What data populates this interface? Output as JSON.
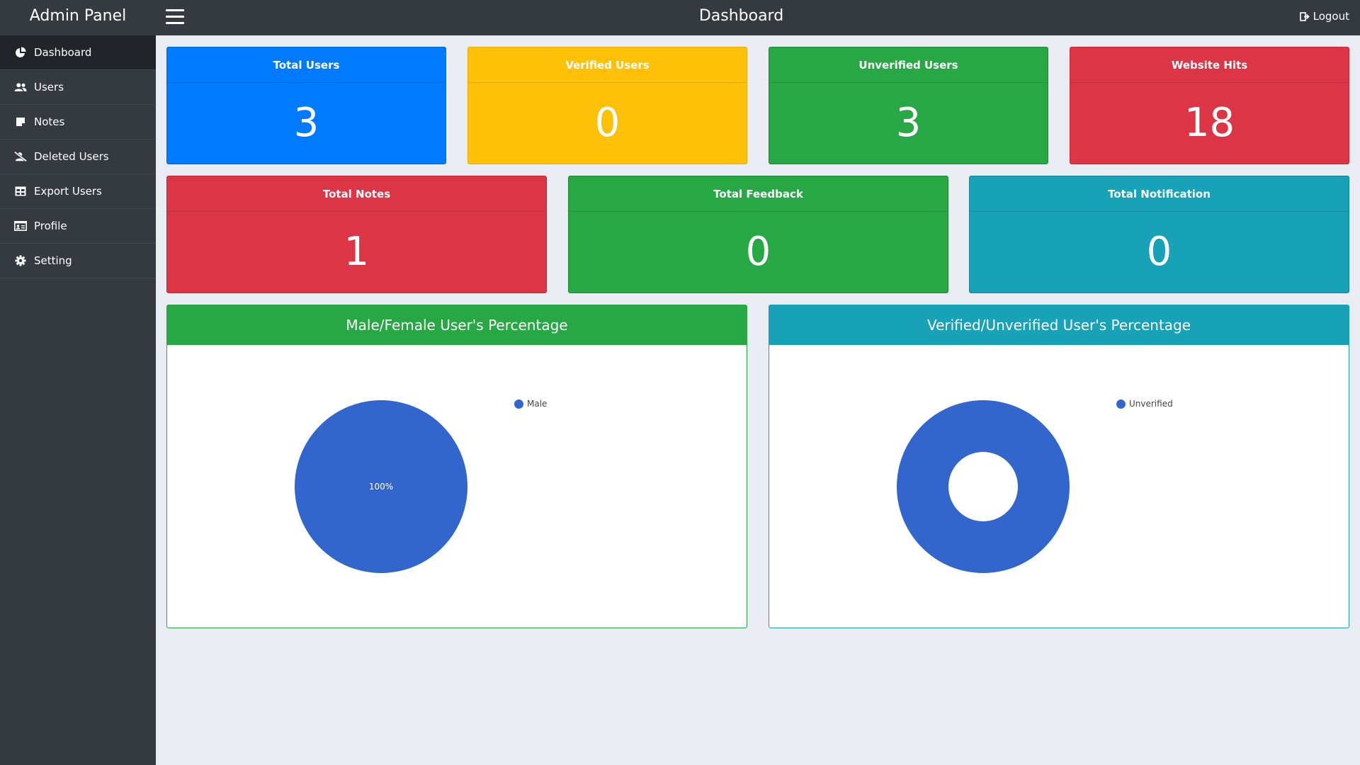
{
  "app": {
    "brand": "Admin Panel",
    "page_title": "Dashboard",
    "logout_label": "Logout"
  },
  "sidebar": {
    "items": [
      {
        "label": "Dashboard",
        "icon": "pie-chart-icon",
        "active": true
      },
      {
        "label": "Users",
        "icon": "users-icon"
      },
      {
        "label": "Notes",
        "icon": "note-icon"
      },
      {
        "label": "Deleted Users",
        "icon": "user-slash-icon"
      },
      {
        "label": "Export Users",
        "icon": "table-icon"
      },
      {
        "label": "Profile",
        "icon": "id-card-icon"
      },
      {
        "label": "Setting",
        "icon": "gear-icon"
      }
    ]
  },
  "stats": {
    "total_users": {
      "label": "Total Users",
      "value": "3",
      "color": "#007bff"
    },
    "verified_users": {
      "label": "Verified Users",
      "value": "0",
      "color": "#ffc107"
    },
    "unverified_users": {
      "label": "Unverified Users",
      "value": "3",
      "color": "#28a745"
    },
    "website_hits": {
      "label": "Website Hits",
      "value": "18",
      "color": "#dc3545"
    },
    "total_notes": {
      "label": "Total Notes",
      "value": "1",
      "color": "#dc3545"
    },
    "total_feedback": {
      "label": "Total Feedback",
      "value": "0",
      "color": "#28a745"
    },
    "total_notification": {
      "label": "Total Notification",
      "value": "0",
      "color": "#17a2b8"
    }
  },
  "charts": {
    "gender": {
      "title": "Male/Female User's Percentage",
      "legend": "Male",
      "slice_label": "100%"
    },
    "verification": {
      "title": "Verified/Unverified User's Percentage",
      "legend": "Unverified"
    }
  },
  "chart_data": [
    {
      "type": "pie",
      "title": "Male/Female User's Percentage",
      "categories": [
        "Male"
      ],
      "values": [
        100
      ],
      "data_labels": [
        "100%"
      ],
      "colors": [
        "#3366cc"
      ],
      "legend": "right"
    },
    {
      "type": "pie",
      "title": "Verified/Unverified User's Percentage",
      "categories": [
        "Unverified"
      ],
      "values": [
        100
      ],
      "donut": true,
      "colors": [
        "#3366cc"
      ],
      "legend": "right"
    }
  ]
}
